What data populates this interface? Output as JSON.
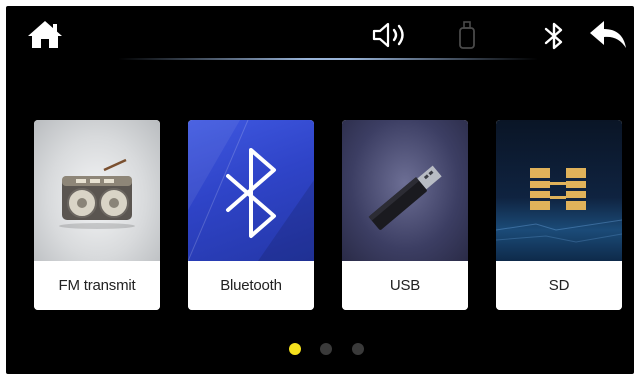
{
  "status_bar": {
    "home_icon": "home-icon",
    "volume_icon": "volume-icon",
    "usb_icon": "usb-stick-icon",
    "bluetooth_icon": "bluetooth-icon",
    "back_icon": "back-arrow-icon"
  },
  "cards": [
    {
      "label": "FM transmit",
      "icon": "radio-icon"
    },
    {
      "label": "Bluetooth",
      "icon": "bluetooth-icon"
    },
    {
      "label": "USB",
      "icon": "usb-drive-icon"
    },
    {
      "label": "SD",
      "icon": "sd-card-icon"
    }
  ],
  "pager": {
    "current": 1,
    "total": 3
  },
  "colors": {
    "background": "#000000",
    "active_dot": "#f5e11d",
    "inactive_dot": "#3a3a3a",
    "bluetooth_card": "#3a52d8"
  }
}
